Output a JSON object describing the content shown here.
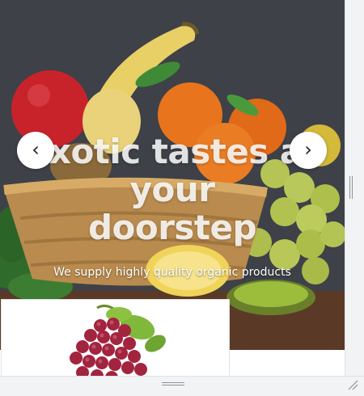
{
  "hero": {
    "title_line1": "Exotic tastes at",
    "title_line2": "your",
    "title_line3": "doorstep",
    "subtitle": "We supply highly quality organic products",
    "image": "fruit-basket"
  },
  "carousel": {
    "prev_label": "‹",
    "next_label": "›",
    "prev_icon": "chevron-left-icon",
    "next_icon": "chevron-right-icon"
  },
  "product_card": {
    "image": "red-grapes"
  },
  "colors": {
    "background": "#3d4047",
    "title": "#ffffff",
    "button": "#ffffff"
  }
}
